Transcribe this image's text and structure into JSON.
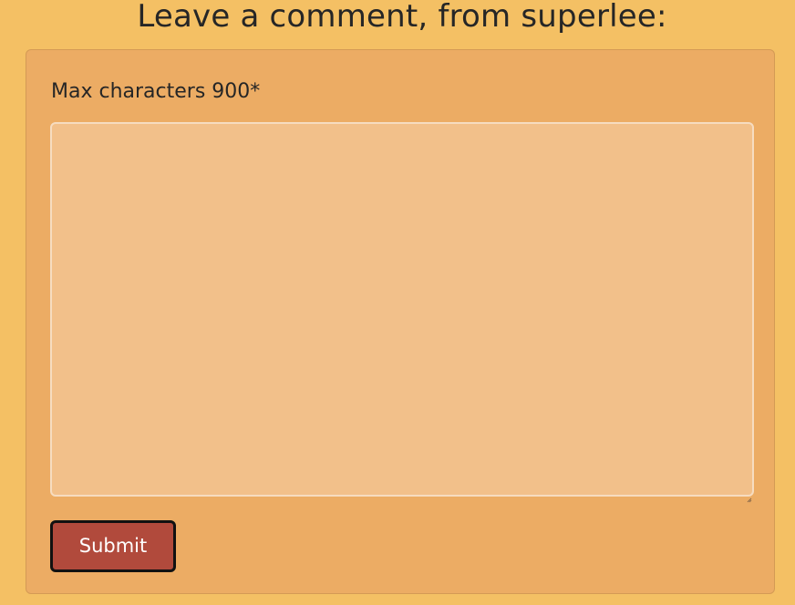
{
  "page": {
    "title": "Leave a comment, from superlee:"
  },
  "form": {
    "label": "Max characters 900*",
    "textarea_value": "",
    "submit_label": "Submit"
  },
  "colors": {
    "page_background": "#f4c064",
    "card_background": "#ecac64",
    "textarea_background": "#f2c08a",
    "submit_background": "#b14a3c",
    "submit_text": "#ffffff"
  },
  "icons": {
    "resize_handle": "resize-handle-icon"
  }
}
